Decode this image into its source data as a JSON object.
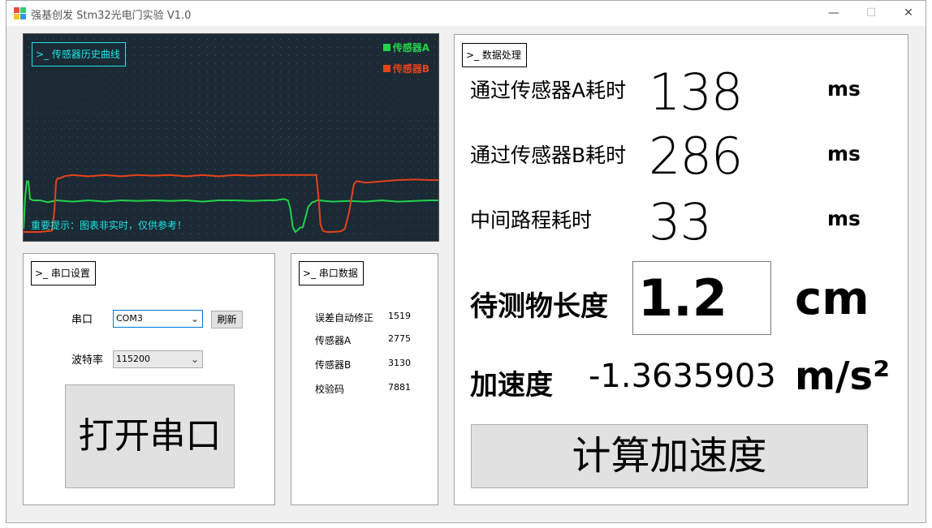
{
  "window": {
    "title": "强基创发 Stm32光电门实验 V1.0",
    "minimize_glyph": "—",
    "maximize_glyph": "☐",
    "close_glyph": "✕"
  },
  "chart_panel": {
    "label": ">_ 传感器历史曲线",
    "hint": "重要提示：图表非实时，仅供参考！"
  },
  "chart_data": {
    "type": "line",
    "title": "",
    "xlabel": "",
    "ylabel": "",
    "grid": true,
    "legend_position": "top-right",
    "series": [
      {
        "name": "传感器A",
        "color": "#22d34a",
        "x": [
          0,
          2,
          4,
          6,
          8,
          12,
          20,
          30,
          40,
          60,
          80,
          100,
          120,
          140,
          160,
          180,
          200,
          220,
          240,
          260,
          280,
          300,
          310,
          320,
          325,
          328,
          331,
          334,
          337,
          340,
          343,
          346,
          350,
          355,
          358,
          361,
          364,
          370,
          380,
          400,
          420,
          440,
          460,
          480,
          500,
          512
        ],
        "values": [
          0.95,
          0.45,
          0.2,
          0.2,
          0.48,
          0.5,
          0.5,
          0.53,
          0.5,
          0.52,
          0.5,
          0.52,
          0.5,
          0.51,
          0.5,
          0.51,
          0.5,
          0.52,
          0.5,
          0.5,
          0.51,
          0.5,
          0.5,
          0.48,
          0.5,
          0.63,
          0.92,
          1.0,
          0.97,
          0.93,
          0.93,
          0.8,
          0.6,
          0.53,
          0.52,
          0.5,
          0.5,
          0.51,
          0.52,
          0.51,
          0.52,
          0.5,
          0.52,
          0.51,
          0.5,
          0.5
        ]
      },
      {
        "name": "传感器B",
        "color": "#e8421a",
        "x": [
          0,
          5,
          20,
          35,
          38,
          40,
          42,
          45,
          50,
          60,
          80,
          100,
          120,
          140,
          160,
          180,
          200,
          220,
          240,
          260,
          280,
          300,
          320,
          340,
          350,
          360,
          363,
          365,
          368,
          372,
          380,
          390,
          395,
          400,
          404,
          406,
          409,
          412,
          420,
          440,
          460,
          480,
          500,
          512
        ],
        "values": [
          1.0,
          1.0,
          1.0,
          0.98,
          0.65,
          0.2,
          0.15,
          0.15,
          0.12,
          0.1,
          0.12,
          0.1,
          0.12,
          0.1,
          0.11,
          0.1,
          0.12,
          0.1,
          0.12,
          0.1,
          0.11,
          0.1,
          0.1,
          0.1,
          0.1,
          0.1,
          0.5,
          0.88,
          0.98,
          1.0,
          1.0,
          0.99,
          0.95,
          0.7,
          0.4,
          0.25,
          0.2,
          0.2,
          0.22,
          0.2,
          0.18,
          0.17,
          0.18,
          0.18
        ]
      }
    ]
  },
  "serial_settings": {
    "label": ">_ 串口设置",
    "port_label": "串口",
    "port_value": "COM3",
    "refresh_button": "刷新",
    "baud_label": "波特率",
    "baud_value": "115200",
    "open_button": "打开串口"
  },
  "serial_data": {
    "label": ">_ 串口数据",
    "rows": [
      {
        "name": "误差自动修正",
        "value": "1519"
      },
      {
        "name": "传感器A",
        "value": "2775"
      },
      {
        "name": "传感器B",
        "value": "3130"
      },
      {
        "name": "校验码",
        "value": "7881"
      }
    ]
  },
  "processing": {
    "label": ">_ 数据处理",
    "sensor_a_label": "通过传感器A耗时",
    "sensor_a_value": "138",
    "sensor_a_unit": "ms",
    "sensor_b_label": "通过传感器B耗时",
    "sensor_b_value": "286",
    "sensor_b_unit": "ms",
    "middle_label": "中间路程耗时",
    "middle_value": "33",
    "middle_unit": "ms",
    "length_label": "待测物长度",
    "length_value": "1.2",
    "length_unit": "cm",
    "accel_label": "加速度",
    "accel_value": "-1.3635903",
    "accel_unit": "m/s²",
    "compute_button": "计算加速度"
  },
  "colors": {
    "chart_bg": "#1b2a35",
    "accent_cyan": "#1ee5e5",
    "focus_blue": "#0078d7"
  }
}
